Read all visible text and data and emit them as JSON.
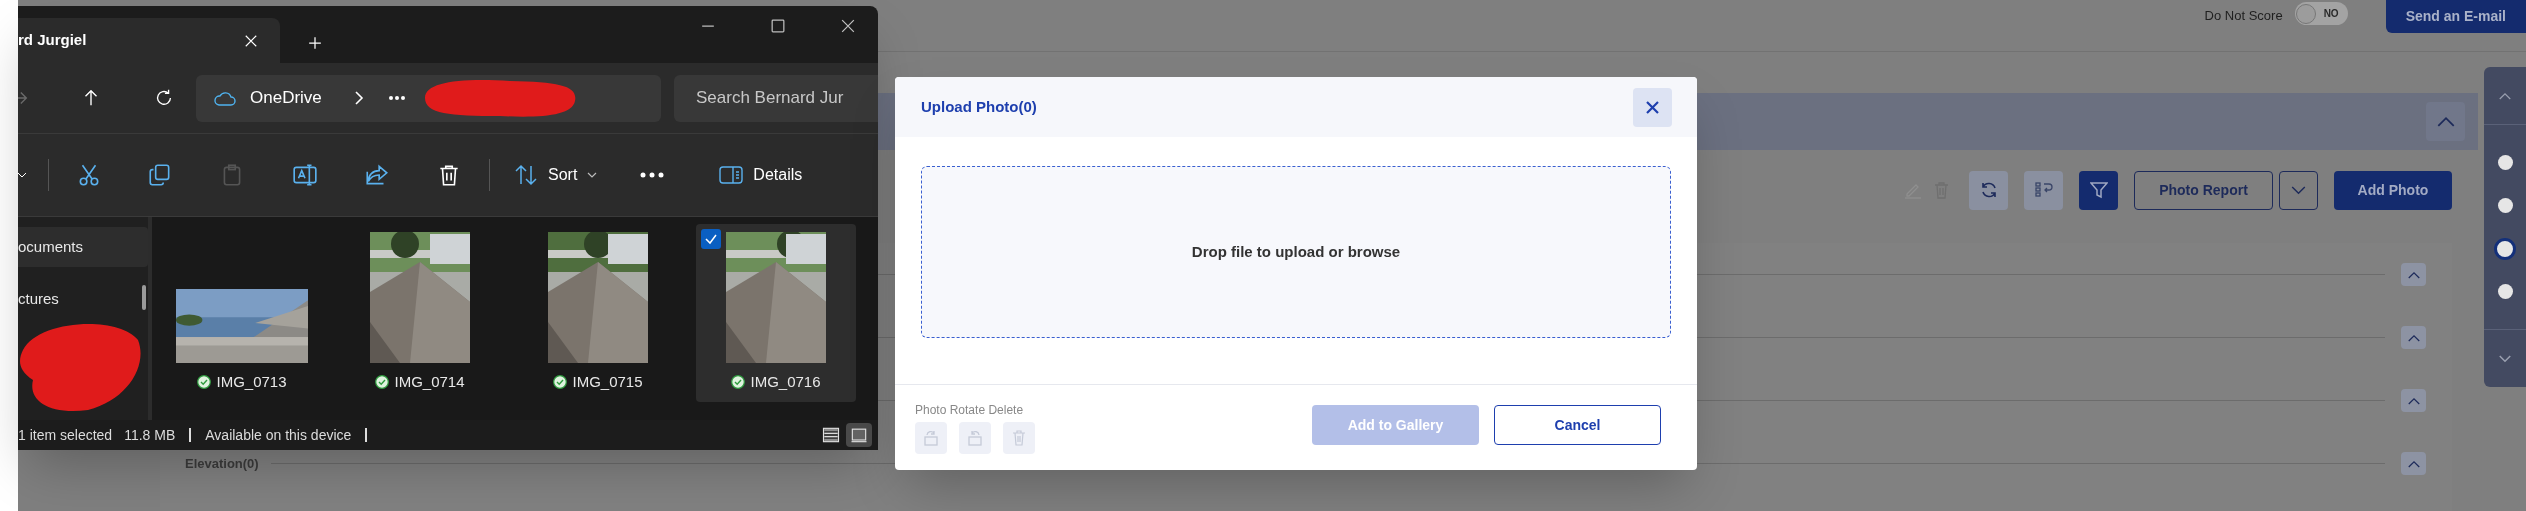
{
  "background_app": {
    "do_not_score": {
      "label": "Do Not Score",
      "on": false,
      "state_text": "NO"
    },
    "send_email_button": "Send an E-mail",
    "photo_toolbar": {
      "photo_report_button": "Photo Report",
      "add_photo_button": "Add Photo"
    },
    "elevation_section": {
      "title": "Elevation(0)"
    },
    "side_nav_dots": [
      {
        "selected": false
      },
      {
        "selected": false
      },
      {
        "selected": true
      },
      {
        "selected": false
      }
    ]
  },
  "file_explorer": {
    "tab_title": "rd Jurgiel",
    "address": "OneDrive",
    "search_placeholder": "Search Bernard Jur",
    "toolbar": {
      "sort": "Sort",
      "details": "Details"
    },
    "sidebar_items": [
      {
        "label": "ocuments",
        "selected": true
      },
      {
        "label": "ctures",
        "selected": false
      }
    ],
    "files": [
      {
        "name": "IMG_0713",
        "kind": "landscape",
        "selected": false,
        "synced": true
      },
      {
        "name": "IMG_0714",
        "kind": "portrait",
        "selected": false,
        "synced": true
      },
      {
        "name": "IMG_0715",
        "kind": "portrait",
        "selected": false,
        "synced": true
      },
      {
        "name": "IMG_0716",
        "kind": "portrait",
        "selected": true,
        "synced": true
      }
    ],
    "status_bar": {
      "selection": "1 item selected",
      "size": "11.8 MB",
      "availability": "Available on this device"
    },
    "view_modes": [
      {
        "kind": "details",
        "selected": false
      },
      {
        "kind": "tiles",
        "selected": true
      }
    ]
  },
  "upload_dialog": {
    "title": "Upload Photo(0)",
    "drop_zone_text": "Drop file to upload or browse",
    "tools_label": "Photo Rotate Delete",
    "tools_disabled": true,
    "add_to_gallery": {
      "label": "Add to Gallery",
      "disabled": true
    },
    "cancel": "Cancel"
  }
}
